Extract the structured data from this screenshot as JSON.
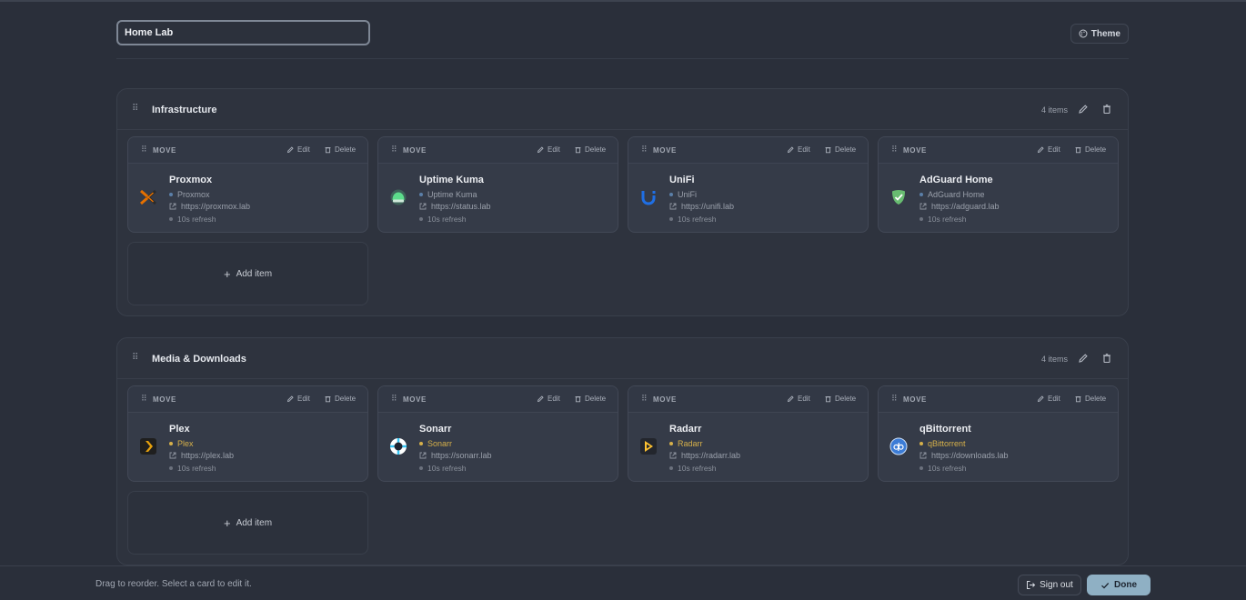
{
  "header": {
    "dashboard_title": "Home Lab",
    "theme_label": "Theme"
  },
  "common": {
    "move_label": "MOVE",
    "edit_label": "Edit",
    "delete_label": "Delete",
    "add_item_label": "Add item"
  },
  "sections": [
    {
      "title": "Infrastructure",
      "count": "4 items",
      "items": [
        {
          "name": "Proxmox",
          "type": "Proxmox",
          "url": "https://proxmox.lab",
          "refresh": "10s refresh",
          "icon": "proxmox-icon"
        },
        {
          "name": "Uptime Kuma",
          "type": "Uptime Kuma",
          "url": "https://status.lab",
          "refresh": "10s refresh",
          "icon": "uptime-kuma-icon"
        },
        {
          "name": "UniFi",
          "type": "UniFi",
          "url": "https://unifi.lab",
          "refresh": "10s refresh",
          "icon": "unifi-icon"
        },
        {
          "name": "AdGuard Home",
          "type": "AdGuard Home",
          "url": "https://adguard.lab",
          "refresh": "10s refresh",
          "icon": "adguard-icon"
        }
      ]
    },
    {
      "title": "Media & Downloads",
      "count": "4 items",
      "items": [
        {
          "name": "Plex",
          "type": "Plex",
          "url": "https://plex.lab",
          "refresh": "10s refresh",
          "icon": "plex-icon"
        },
        {
          "name": "Sonarr",
          "type": "Sonarr",
          "url": "https://sonarr.lab",
          "refresh": "10s refresh",
          "icon": "sonarr-icon"
        },
        {
          "name": "Radarr",
          "type": "Radarr",
          "url": "https://radarr.lab",
          "refresh": "10s refresh",
          "icon": "radarr-icon"
        },
        {
          "name": "qBittorrent",
          "type": "qBittorrent",
          "url": "https://downloads.lab",
          "refresh": "10s refresh",
          "icon": "qbittorrent-icon"
        }
      ]
    }
  ],
  "footer": {
    "hint": "Drag to reorder. Select a card to edit it.",
    "sign_out_label": "Sign out",
    "done_label": "Done"
  },
  "colors": {
    "background": "#2a2f3a",
    "accent": "#8fb0c4",
    "type_dot_infra": "#5b7fa8",
    "type_dot_media": "#d6b04a",
    "type_text_media": "#d6b04a"
  }
}
